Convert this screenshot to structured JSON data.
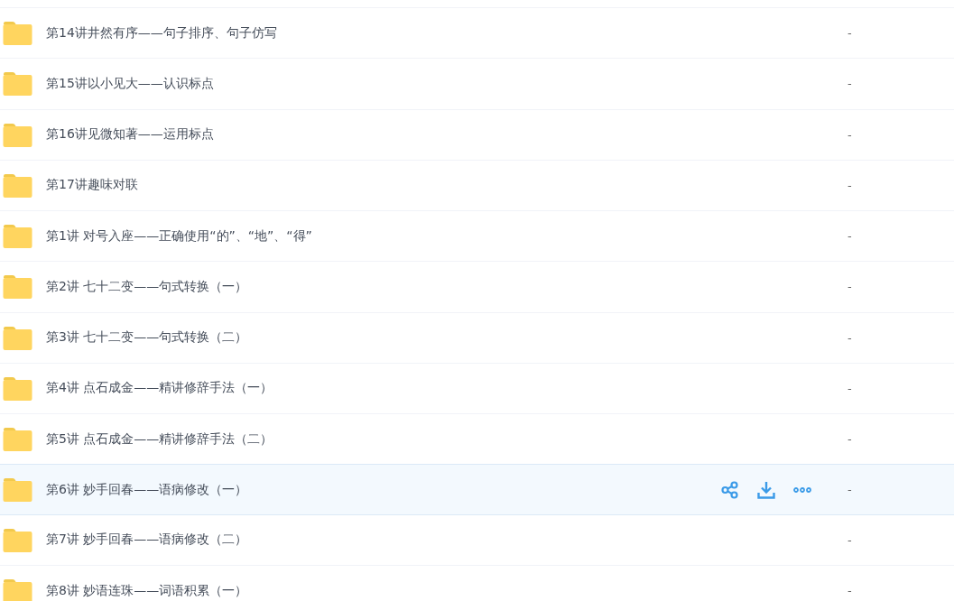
{
  "files": [
    {
      "name": "第14讲井然有序——句子排序、句子仿写",
      "column_2": "-",
      "highlighted": false
    },
    {
      "name": "第15讲以小见大——认识标点",
      "column_2": "-",
      "highlighted": false
    },
    {
      "name": "第16讲见微知著——运用标点",
      "column_2": "-",
      "highlighted": false
    },
    {
      "name": "第17讲趣味对联",
      "column_2": "-",
      "highlighted": false
    },
    {
      "name": "第1讲 对号入座——正确使用“的”、“地”、“得”",
      "column_2": "-",
      "highlighted": false
    },
    {
      "name": "第2讲 七十二变——句式转换（一）",
      "column_2": "-",
      "highlighted": false
    },
    {
      "name": "第3讲 七十二变——句式转换（二）",
      "column_2": "-",
      "highlighted": false
    },
    {
      "name": "第4讲 点石成金——精讲修辞手法（一）",
      "column_2": "-",
      "highlighted": false
    },
    {
      "name": "第5讲 点石成金——精讲修辞手法（二）",
      "column_2": "-",
      "highlighted": false
    },
    {
      "name": "第6讲 妙手回春——语病修改（一）",
      "column_2": "-",
      "highlighted": true
    },
    {
      "name": "第7讲 妙手回春——语病修改（二）",
      "column_2": "-",
      "highlighted": false
    },
    {
      "name": "第8讲 妙语连珠——词语积累（一）",
      "column_2": "-",
      "highlighted": false
    }
  ]
}
